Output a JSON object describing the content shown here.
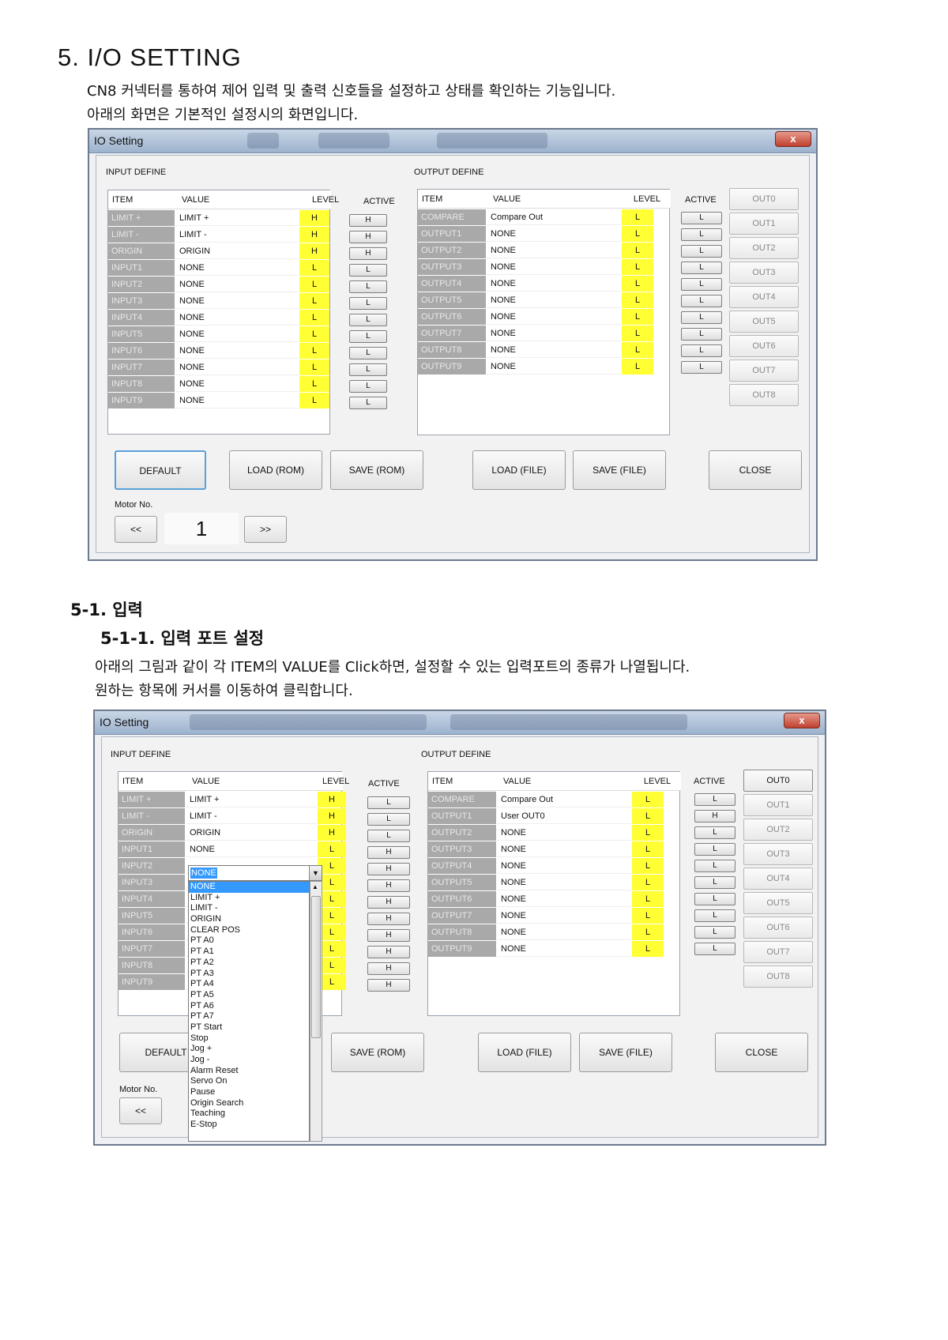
{
  "doc": {
    "heading": "5.  I/O SETTING",
    "intro_1": "CN8 커넥터를 통하여 제어 입력 및 출력 신호들을 설정하고 상태를 확인하는 기능입니다.",
    "intro_2": "아래의 화면은 기본적인 설정시의 화면입니다.",
    "sec_1": "5-1. 입력",
    "sec_1_1": "5-1-1. 입력 포트 설정",
    "desc_1": "아래의 그림과 같이 각 ITEM의 VALUE를 Click하면, 설정할 수 있는 입력포트의 종류가 나열됩니다.",
    "desc_2": "원하는 항목에 커서를 이동하여 클릭합니다."
  },
  "common": {
    "title": "IO Setting",
    "close_x": "x",
    "input_define": "INPUT DEFINE",
    "output_define": "OUTPUT DEFINE",
    "col_item": "ITEM",
    "col_value": "VALUE",
    "col_level": "LEVEL",
    "col_active": "ACTIVE",
    "btn_default": "DEFAULT",
    "btn_load_rom": "LOAD (ROM)",
    "btn_save_rom": "SAVE (ROM)",
    "btn_load_file": "LOAD (FILE)",
    "btn_save_file": "SAVE (FILE)",
    "btn_close": "CLOSE",
    "motor_no": "Motor No.",
    "prev": "<<",
    "next": ">>",
    "motor_value": "1",
    "out_buttons": [
      "OUT0",
      "OUT1",
      "OUT2",
      "OUT3",
      "OUT4",
      "OUT5",
      "OUT6",
      "OUT7",
      "OUT8"
    ]
  },
  "win1": {
    "inputs": [
      {
        "item": "LIMIT +",
        "value": "LIMIT +",
        "level": "H",
        "active": "H"
      },
      {
        "item": "LIMIT -",
        "value": "LIMIT -",
        "level": "H",
        "active": "H"
      },
      {
        "item": "ORIGIN",
        "value": "ORIGIN",
        "level": "H",
        "active": "H"
      },
      {
        "item": "INPUT1",
        "value": "NONE",
        "level": "L",
        "active": "L"
      },
      {
        "item": "INPUT2",
        "value": "NONE",
        "level": "L",
        "active": "L"
      },
      {
        "item": "INPUT3",
        "value": "NONE",
        "level": "L",
        "active": "L"
      },
      {
        "item": "INPUT4",
        "value": "NONE",
        "level": "L",
        "active": "L"
      },
      {
        "item": "INPUT5",
        "value": "NONE",
        "level": "L",
        "active": "L"
      },
      {
        "item": "INPUT6",
        "value": "NONE",
        "level": "L",
        "active": "L"
      },
      {
        "item": "INPUT7",
        "value": "NONE",
        "level": "L",
        "active": "L"
      },
      {
        "item": "INPUT8",
        "value": "NONE",
        "level": "L",
        "active": "L"
      },
      {
        "item": "INPUT9",
        "value": "NONE",
        "level": "L",
        "active": "L"
      }
    ],
    "outputs": [
      {
        "item": "COMPARE",
        "value": "Compare Out",
        "level": "L",
        "active": "L"
      },
      {
        "item": "OUTPUT1",
        "value": "NONE",
        "level": "L",
        "active": "L"
      },
      {
        "item": "OUTPUT2",
        "value": "NONE",
        "level": "L",
        "active": "L"
      },
      {
        "item": "OUTPUT3",
        "value": "NONE",
        "level": "L",
        "active": "L"
      },
      {
        "item": "OUTPUT4",
        "value": "NONE",
        "level": "L",
        "active": "L"
      },
      {
        "item": "OUTPUT5",
        "value": "NONE",
        "level": "L",
        "active": "L"
      },
      {
        "item": "OUTPUT6",
        "value": "NONE",
        "level": "L",
        "active": "L"
      },
      {
        "item": "OUTPUT7",
        "value": "NONE",
        "level": "L",
        "active": "L"
      },
      {
        "item": "OUTPUT8",
        "value": "NONE",
        "level": "L",
        "active": "L"
      },
      {
        "item": "OUTPUT9",
        "value": "NONE",
        "level": "L",
        "active": "L"
      }
    ]
  },
  "win2": {
    "inputs": [
      {
        "item": "LIMIT +",
        "value": "LIMIT +",
        "level": "H",
        "active": "L"
      },
      {
        "item": "LIMIT -",
        "value": "LIMIT -",
        "level": "H",
        "active": "L"
      },
      {
        "item": "ORIGIN",
        "value": "ORIGIN",
        "level": "H",
        "active": "L"
      },
      {
        "item": "INPUT1",
        "value": "NONE",
        "level": "L",
        "active": "H"
      },
      {
        "item": "INPUT2",
        "value": "",
        "level": "L",
        "active": "H"
      },
      {
        "item": "INPUT3",
        "value": "",
        "level": "L",
        "active": "H"
      },
      {
        "item": "INPUT4",
        "value": "",
        "level": "L",
        "active": "H"
      },
      {
        "item": "INPUT5",
        "value": "",
        "level": "L",
        "active": "H"
      },
      {
        "item": "INPUT6",
        "value": "",
        "level": "L",
        "active": "H"
      },
      {
        "item": "INPUT7",
        "value": "",
        "level": "L",
        "active": "H"
      },
      {
        "item": "INPUT8",
        "value": "",
        "level": "L",
        "active": "H"
      },
      {
        "item": "INPUT9",
        "value": "",
        "level": "L",
        "active": "H"
      }
    ],
    "outputs": [
      {
        "item": "COMPARE",
        "value": "Compare Out",
        "level": "L",
        "active": "L"
      },
      {
        "item": "OUTPUT1",
        "value": "User OUT0",
        "level": "L",
        "active": "H"
      },
      {
        "item": "OUTPUT2",
        "value": "NONE",
        "level": "L",
        "active": "L"
      },
      {
        "item": "OUTPUT3",
        "value": "NONE",
        "level": "L",
        "active": "L"
      },
      {
        "item": "OUTPUT4",
        "value": "NONE",
        "level": "L",
        "active": "L"
      },
      {
        "item": "OUTPUT5",
        "value": "NONE",
        "level": "L",
        "active": "L"
      },
      {
        "item": "OUTPUT6",
        "value": "NONE",
        "level": "L",
        "active": "L"
      },
      {
        "item": "OUTPUT7",
        "value": "NONE",
        "level": "L",
        "active": "L"
      },
      {
        "item": "OUTPUT8",
        "value": "NONE",
        "level": "L",
        "active": "L"
      },
      {
        "item": "OUTPUT9",
        "value": "NONE",
        "level": "L",
        "active": "L"
      }
    ],
    "dropdown_selected": "NONE",
    "dropdown_options": [
      "NONE",
      "LIMIT +",
      "LIMIT -",
      "ORIGIN",
      "CLEAR POS",
      "PT A0",
      "PT A1",
      "PT A2",
      "PT A3",
      "PT A4",
      "PT A5",
      "PT A6",
      "PT A7",
      "PT Start",
      "Stop",
      "Jog +",
      "Jog -",
      "Alarm Reset",
      "Servo On",
      "Pause",
      "Origin Search",
      "Teaching",
      "E-Stop"
    ]
  },
  "colors": {
    "level_bg": "#ffff33",
    "item_bg": "#a9a9a9",
    "selection": "#3399ff"
  }
}
